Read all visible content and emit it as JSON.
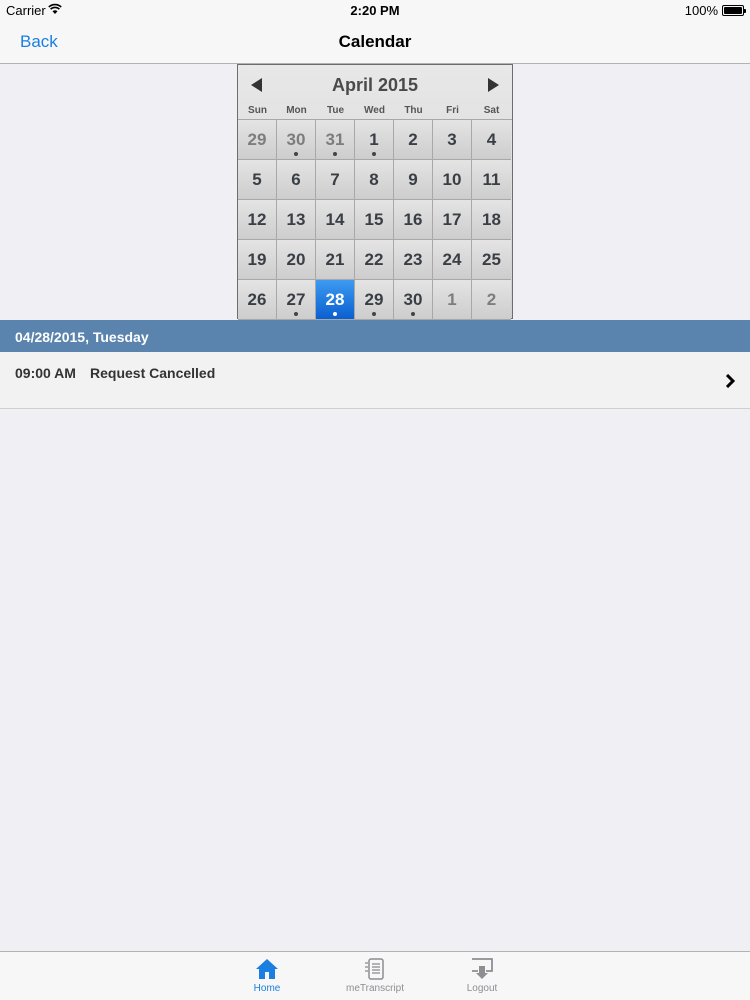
{
  "status": {
    "carrier": "Carrier",
    "time": "2:20 PM",
    "battery": "100%"
  },
  "nav": {
    "back": "Back",
    "title": "Calendar"
  },
  "calendar": {
    "month": "April 2015",
    "weekdays": [
      "Sun",
      "Mon",
      "Tue",
      "Wed",
      "Thu",
      "Fri",
      "Sat"
    ],
    "selected_day": "28",
    "cells": [
      {
        "day": "29",
        "other": true,
        "dot": false
      },
      {
        "day": "30",
        "other": true,
        "dot": true
      },
      {
        "day": "31",
        "other": true,
        "dot": true
      },
      {
        "day": "1",
        "other": false,
        "dot": true
      },
      {
        "day": "2",
        "other": false,
        "dot": false
      },
      {
        "day": "3",
        "other": false,
        "dot": false
      },
      {
        "day": "4",
        "other": false,
        "dot": false
      },
      {
        "day": "5",
        "other": false,
        "dot": false
      },
      {
        "day": "6",
        "other": false,
        "dot": false
      },
      {
        "day": "7",
        "other": false,
        "dot": false
      },
      {
        "day": "8",
        "other": false,
        "dot": false
      },
      {
        "day": "9",
        "other": false,
        "dot": false
      },
      {
        "day": "10",
        "other": false,
        "dot": false
      },
      {
        "day": "11",
        "other": false,
        "dot": false
      },
      {
        "day": "12",
        "other": false,
        "dot": false
      },
      {
        "day": "13",
        "other": false,
        "dot": false
      },
      {
        "day": "14",
        "other": false,
        "dot": false
      },
      {
        "day": "15",
        "other": false,
        "dot": false
      },
      {
        "day": "16",
        "other": false,
        "dot": false
      },
      {
        "day": "17",
        "other": false,
        "dot": false
      },
      {
        "day": "18",
        "other": false,
        "dot": false
      },
      {
        "day": "19",
        "other": false,
        "dot": false
      },
      {
        "day": "20",
        "other": false,
        "dot": false
      },
      {
        "day": "21",
        "other": false,
        "dot": false
      },
      {
        "day": "22",
        "other": false,
        "dot": false
      },
      {
        "day": "23",
        "other": false,
        "dot": false
      },
      {
        "day": "24",
        "other": false,
        "dot": false
      },
      {
        "day": "25",
        "other": false,
        "dot": false
      },
      {
        "day": "26",
        "other": false,
        "dot": false
      },
      {
        "day": "27",
        "other": false,
        "dot": true
      },
      {
        "day": "28",
        "other": false,
        "dot": true
      },
      {
        "day": "29",
        "other": false,
        "dot": true
      },
      {
        "day": "30",
        "other": false,
        "dot": true
      },
      {
        "day": "1",
        "other": true,
        "dot": false
      },
      {
        "day": "2",
        "other": true,
        "dot": false
      }
    ]
  },
  "section": {
    "date_label": "04/28/2015, Tuesday"
  },
  "event": {
    "time": "09:00 AM",
    "title": "Request Cancelled"
  },
  "tabs": [
    {
      "label": "Home",
      "icon": "home-icon",
      "active": true
    },
    {
      "label": "meTranscript",
      "icon": "transcript-icon",
      "active": false
    },
    {
      "label": "Logout",
      "icon": "logout-icon",
      "active": false
    }
  ],
  "colors": {
    "accent": "#1a7fe0",
    "section_header": "#5a84ae",
    "selected_day": "#1a6fe0"
  }
}
